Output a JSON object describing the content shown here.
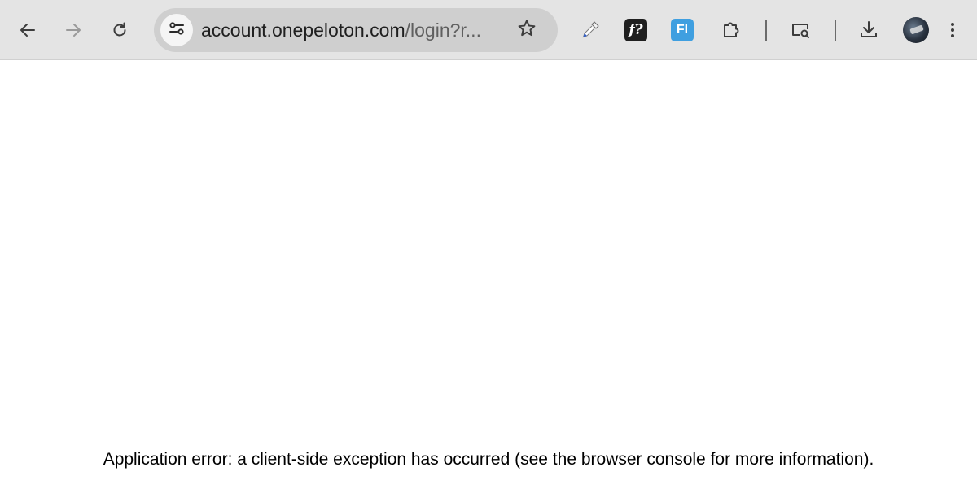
{
  "browser": {
    "url": {
      "host": "account.onepeloton.com",
      "rest": "/login?r..."
    },
    "icons": {
      "back": "arrow-left-icon",
      "forward": "arrow-right-icon",
      "reload": "reload-icon",
      "site_info": "tune-icon",
      "bookmark": "star-icon",
      "eyedropper": "eyedropper-icon",
      "font_ext": "font-question-icon",
      "fi_ext": "fi-extension-icon",
      "extensions": "puzzle-icon",
      "screen_search": "screen-search-icon",
      "downloads": "download-icon",
      "menu": "kebab-menu-icon"
    },
    "extensions": {
      "font_label": "f?",
      "fi_label": "FI"
    },
    "colors": {
      "toolbar_bg": "#e4e4e4",
      "omnibox_bg": "#cfcfcf",
      "fi_ext_bg": "#3f9fe0",
      "font_ext_bg": "#1f1f1f"
    }
  },
  "page": {
    "error_message": "Application error: a client-side exception has occurred (see the browser console for more information)."
  }
}
